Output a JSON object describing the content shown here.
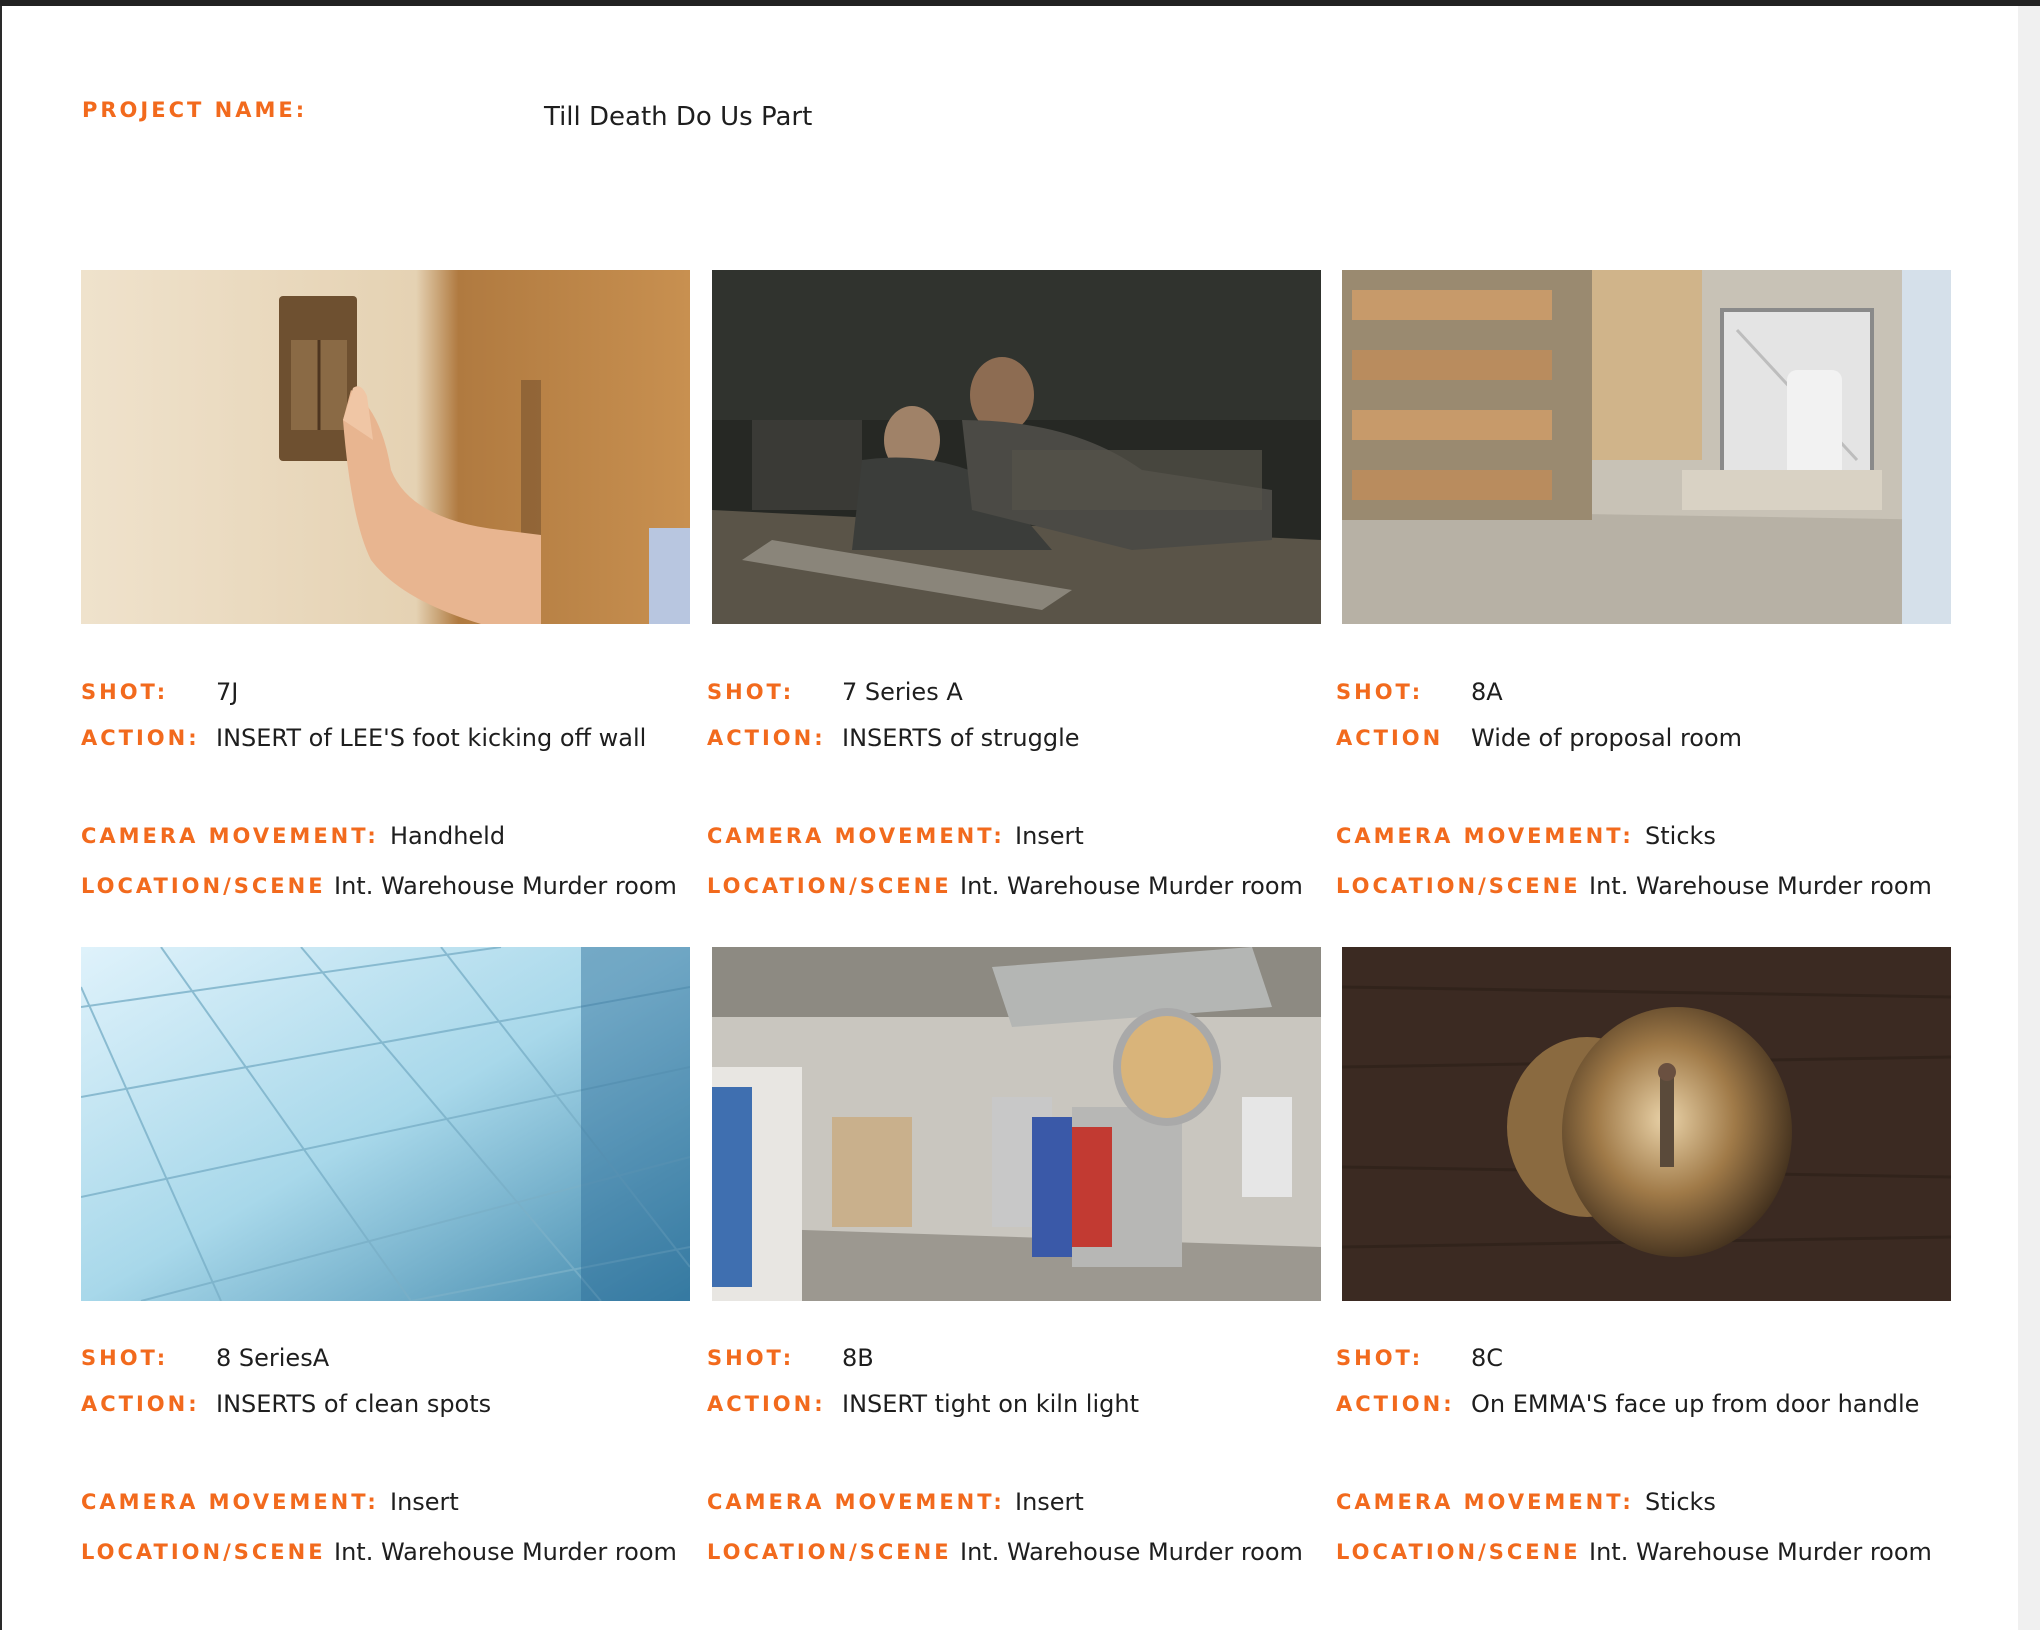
{
  "project": {
    "label": "PROJECT NAME:",
    "name": "Till Death Do Us Part"
  },
  "shots": [
    {
      "shot_label": "SHOT:",
      "shot": "7J",
      "action_label": "ACTION:",
      "action": "INSERT of LEE'S foot kicking off wall",
      "camera_label": "CAMERA MOVEMENT:",
      "camera": "Handheld",
      "location_label": "LOCATION/SCENE",
      "location": "Int. Warehouse Murder room",
      "image": "finger-pressing-light-switch"
    },
    {
      "shot_label": "SHOT:",
      "shot": "7 Series A",
      "action_label": "ACTION:",
      "action": "INSERTS of struggle",
      "camera_label": "CAMERA MOVEMENT:",
      "camera": "Insert",
      "location_label": "LOCATION/SCENE",
      "location": "Int. Warehouse Murder room",
      "image": "two-men-struggling-on-desk"
    },
    {
      "shot_label": "SHOT:",
      "shot": "8A",
      "action_label": "ACTION",
      "action": "Wide of proposal room",
      "camera_label": "CAMERA MOVEMENT:",
      "camera": "Sticks",
      "location_label": "LOCATION/SCENE",
      "location": "Int. Warehouse Murder room",
      "image": "warehouse-shelves-room"
    },
    {
      "shot_label": "SHOT:",
      "shot": "8 SeriesA",
      "action_label": "ACTION:",
      "action": "INSERTS of clean spots",
      "camera_label": "CAMERA MOVEMENT:",
      "camera": "Insert",
      "location_label": "LOCATION/SCENE",
      "location": "Int. Warehouse Murder room",
      "image": "shiny-tile-floor"
    },
    {
      "shot_label": "SHOT:",
      "shot": "8B",
      "action_label": "ACTION:",
      "action": "INSERT tight on kiln light",
      "camera_label": "CAMERA MOVEMENT:",
      "camera": "Insert",
      "location_label": "LOCATION/SCENE",
      "location": "Int. Warehouse Murder room",
      "image": "kiln-room"
    },
    {
      "shot_label": "SHOT:",
      "shot": "8C",
      "action_label": "ACTION:",
      "action": "On EMMA'S face up from door handle",
      "camera_label": "CAMERA MOVEMENT:",
      "camera": "Sticks",
      "location_label": "LOCATION/SCENE",
      "location": "Int. Warehouse Murder room",
      "image": "door-knob-reflection"
    }
  ]
}
